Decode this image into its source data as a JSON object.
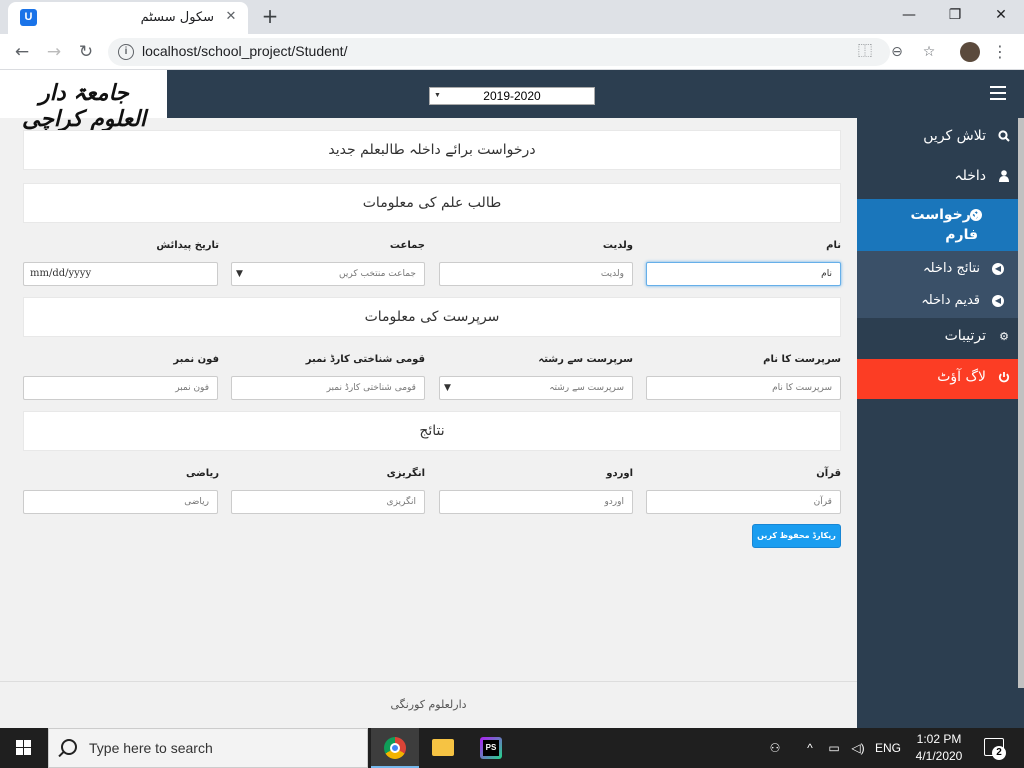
{
  "browser": {
    "tab_title": "سکول سسٹم",
    "tab_favicon": "U",
    "url": "localhost/school_project/Student/",
    "icons": [
      "back-icon",
      "forward-icon",
      "reload-icon",
      "info-icon",
      "translate-icon",
      "zoom-icon",
      "star-icon",
      "profile-avatar",
      "menu-icon"
    ]
  },
  "header": {
    "logo_text": "جامعۃ دار العلوم کراچی",
    "year_select": "2019-2020"
  },
  "sidebar": {
    "items": [
      {
        "label": "تلاش کریں",
        "icon": "search-icon"
      },
      {
        "label": "داخلہ",
        "icon": "user-icon"
      },
      {
        "label": "درخواست فارم",
        "icon": "arrow-circle-icon"
      },
      {
        "label": "ترتیبات",
        "icon": "gear-icon"
      },
      {
        "label": "لاگ آؤٹ",
        "icon": "power-icon"
      }
    ],
    "sub_items": [
      {
        "label": "نتائج داخلہ",
        "icon": "arrow-circle-icon"
      },
      {
        "label": "قدیم داخلہ",
        "icon": "arrow-circle-icon"
      }
    ],
    "colors": {
      "bg": "#2c3e50",
      "active": "#1a76bb",
      "logout": "#fc3d24"
    }
  },
  "form": {
    "title": "درخواست برائے داخلہ طالبعلم جدید",
    "student_section": "طالب علم کی معلومات",
    "student_fields": {
      "name_label": "نام",
      "name_placeholder": "نام",
      "father_label": "ولدیت",
      "father_placeholder": "ولدیت",
      "class_label": "جماعت",
      "class_placeholder": "جماعت منتخب کریں",
      "dob_label": "تاریخ پیدائش",
      "dob_placeholder": "mm/dd/yyyy"
    },
    "guardian_section": "سرپرست کی معلومات",
    "guardian_fields": {
      "name_label": "سرپرست کا نام",
      "name_placeholder": "سرپرست کا نام",
      "relation_label": "سرپرست سے رشتہ",
      "relation_placeholder": "سرپرست سے رشتہ",
      "cnic_label": "قومی شناختی کارڈ نمبر",
      "cnic_placeholder": "قومی شناختی کارڈ نمبر",
      "phone_label": "فون نمبر",
      "phone_placeholder": "فون نمبر"
    },
    "results_section": "نتائج",
    "results_fields": {
      "quran_label": "قرآن",
      "quran_placeholder": "قرآن",
      "urdu_label": "اوردو",
      "urdu_placeholder": "اوردو",
      "english_label": "انگریزی",
      "english_placeholder": "انگریزی",
      "math_label": "ریاضی",
      "math_placeholder": "ریاضی"
    },
    "save_button": "ریکارڈ محفوظ کریں"
  },
  "footer": {
    "text": "دارلعلوم کورنگی"
  },
  "taskbar": {
    "search_placeholder": "Type here to search",
    "language": "ENG",
    "time": "1:02 PM",
    "date": "4/1/2020",
    "notification_count": "2"
  }
}
